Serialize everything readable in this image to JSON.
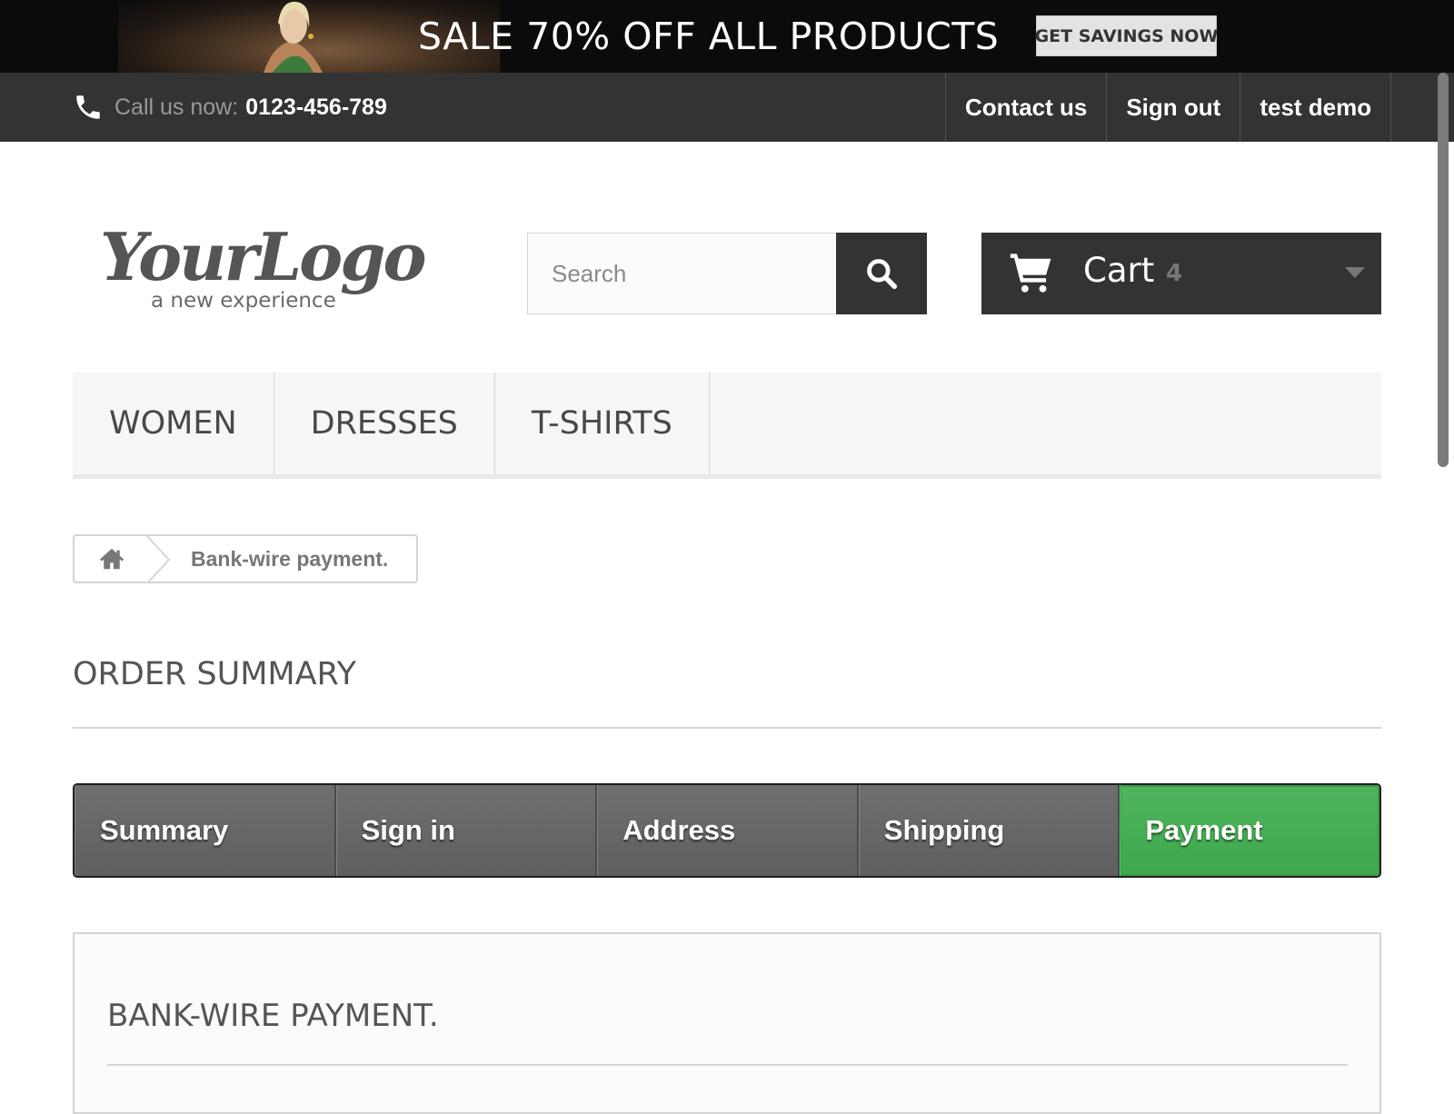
{
  "promo": {
    "headline": "SALE 70% OFF ALL PRODUCTS",
    "button_label": "GET SAVINGS NOW"
  },
  "top_nav": {
    "phone_label": "Call us now:",
    "phone_number": "0123-456-789",
    "links": [
      "Contact us",
      "Sign out",
      "test demo"
    ]
  },
  "logo": {
    "main": "YourLogo",
    "tagline": "a new experience"
  },
  "search": {
    "placeholder": "Search",
    "value": ""
  },
  "cart": {
    "label": "Cart",
    "count": "4"
  },
  "main_menu": [
    "WOMEN",
    "DRESSES",
    "T-SHIRTS"
  ],
  "breadcrumb": {
    "current": "Bank-wire payment."
  },
  "page_title": "ORDER SUMMARY",
  "steps": {
    "items": [
      "Summary",
      "Sign in",
      "Address",
      "Shipping",
      "Payment"
    ],
    "active": "Payment"
  },
  "content": {
    "heading": "BANK-WIRE PAYMENT."
  },
  "colors": {
    "dark_bar": "#333333",
    "step_active": "#46ae55",
    "step_inactive": "#666666"
  },
  "icons": {
    "phone": "phone-icon",
    "search": "search-icon",
    "cart": "cart-icon",
    "cart_dropdown": "chevron-down-icon",
    "home": "home-icon"
  }
}
